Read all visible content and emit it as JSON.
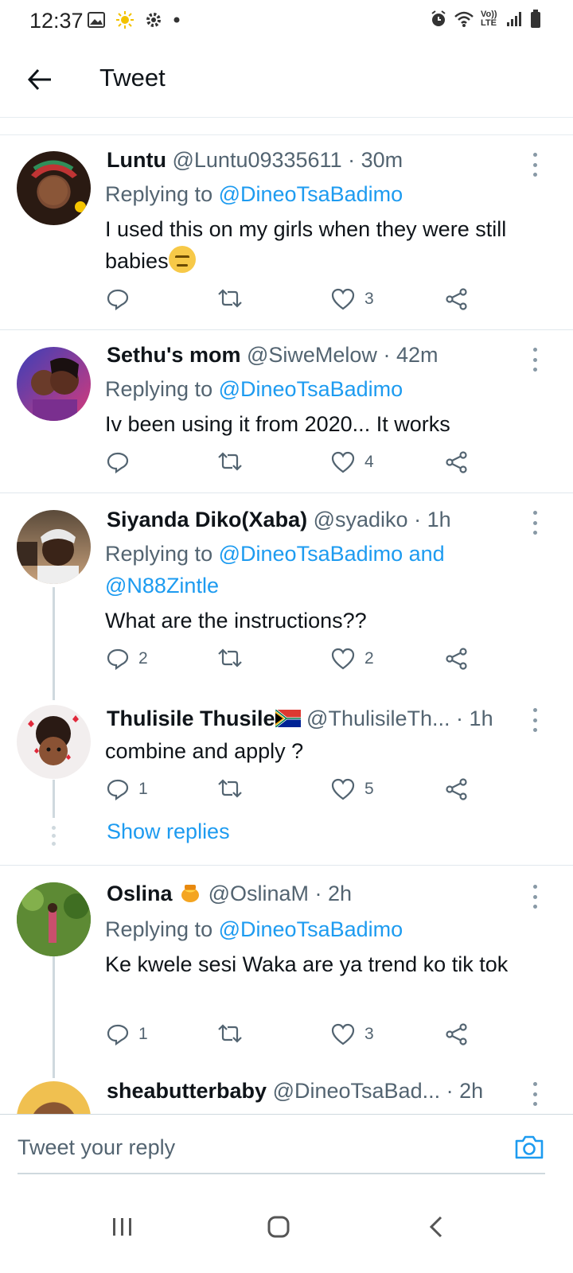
{
  "status_bar": {
    "time": "12:37",
    "network_label": "Vo)) LTE"
  },
  "header": {
    "title": "Tweet"
  },
  "tweets": [
    {
      "name": "Luntu",
      "handle": "@Luntu09335611",
      "time": "30m",
      "replying_label": "Replying to",
      "mentions": "@DineoTsaBadimo",
      "body": "I used this on my girls when they were still babies",
      "reply_count": "",
      "like_count": "3"
    },
    {
      "name": "Sethu's mom",
      "handle": "@SiweMelow",
      "time": "42m",
      "replying_label": "Replying to",
      "mentions": "@DineoTsaBadimo",
      "body": "Iv been using it from 2020... It works",
      "reply_count": "",
      "like_count": "4"
    },
    {
      "name": "Siyanda Diko(Xaba)",
      "handle": "@syadiko",
      "time": "1h",
      "replying_label": "Replying to",
      "mentions": "@DineoTsaBadimo and",
      "mentions_line2": "@N88Zintle",
      "body": "What are the instructions??",
      "reply_count": "2",
      "like_count": "2"
    },
    {
      "name": "Thulisile Thusile",
      "handle": "@ThulisileTh...",
      "time": "1h",
      "body": "combine and apply ?",
      "reply_count": "1",
      "like_count": "5"
    },
    {
      "name": "Oslina",
      "handle": "@OslinaM",
      "time": "2h",
      "replying_label": "Replying to",
      "mentions": "@DineoTsaBadimo",
      "body": "Ke kwele sesi Waka are ya trend ko tik tok",
      "reply_count": "1",
      "like_count": "3"
    },
    {
      "name": "sheabutterbaby",
      "handle": "@DineoTsaBad...",
      "time": "2h"
    }
  ],
  "show_replies_label": "Show replies",
  "compose": {
    "placeholder": "Tweet your reply"
  },
  "colors": {
    "accent": "#1d9bf0",
    "secondary_text": "#536471",
    "divider": "#e1e8ed"
  }
}
